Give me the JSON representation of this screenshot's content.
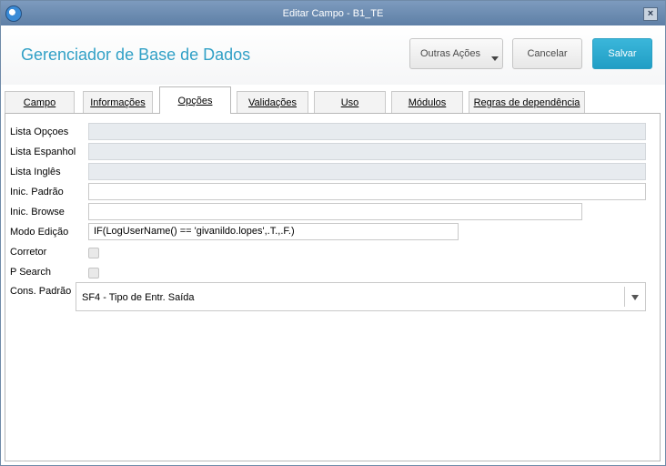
{
  "window": {
    "title": "Editar Campo - B1_TE",
    "close_label": "×"
  },
  "header": {
    "app_title": "Gerenciador de Base de Dados",
    "more_actions_label": "Outras Ações",
    "cancel_label": "Cancelar",
    "save_label": "Salvar"
  },
  "tabs": [
    "Campo",
    "Informações",
    "Opções",
    "Validações",
    "Uso",
    "Módulos",
    "Regras de dependência"
  ],
  "active_tab": "Opções",
  "form": {
    "lista_opcoes": {
      "label": "Lista Opçoes",
      "value": ""
    },
    "lista_espanhol": {
      "label": "Lista Espanhol",
      "value": ""
    },
    "lista_ingles": {
      "label": "Lista Inglês",
      "value": ""
    },
    "inic_padrao": {
      "label": "Inic. Padrão",
      "value": ""
    },
    "inic_browse": {
      "label": "Inic. Browse",
      "value": ""
    },
    "modo_edicao": {
      "label": "Modo Edição",
      "value": "IF(LogUserName() == 'givanildo.lopes',.T.,.F.)"
    },
    "corretor": {
      "label": "Corretor",
      "checked": false
    },
    "p_search": {
      "label": "P Search",
      "checked": false
    },
    "cons_padrao": {
      "label": "Cons. Padrão",
      "value": "SF4 - Tipo de Entr. Saída"
    }
  },
  "colors": {
    "accent": "#31a0c6",
    "save_button": "#2aa7cf",
    "titlebar": "#6e8db3"
  }
}
